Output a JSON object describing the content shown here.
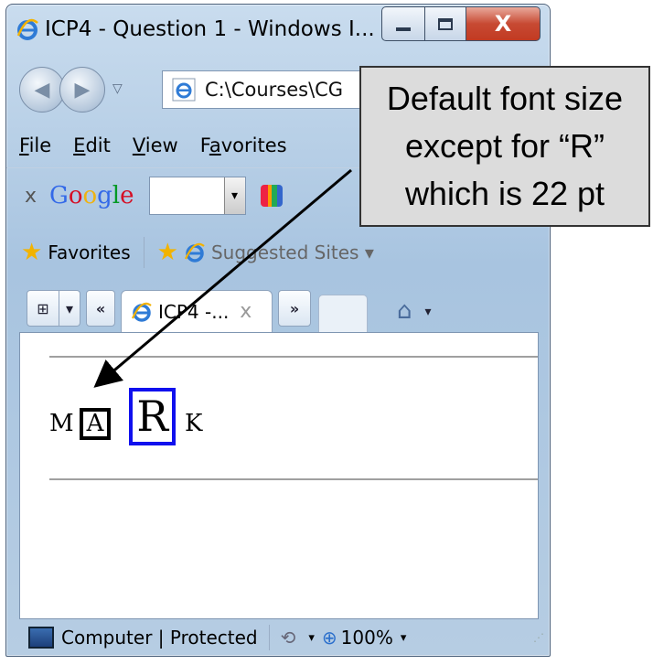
{
  "window": {
    "title": "ICP4 - Question 1 - Windows I...",
    "caption_min": "",
    "caption_max": "",
    "caption_close": "X"
  },
  "address_bar": {
    "url": "C:\\Courses\\CG"
  },
  "menu": {
    "items": [
      {
        "label": "File",
        "key": "F",
        "rest": "ile"
      },
      {
        "label": "Edit",
        "key": "E",
        "rest": "dit"
      },
      {
        "label": "View",
        "key": "V",
        "rest": "iew"
      },
      {
        "label": "Favorites",
        "pre": "F",
        "key": "a",
        "rest": "vorites"
      }
    ]
  },
  "google_bar": {
    "close": "x",
    "logo": "Google",
    "search_value": ""
  },
  "favorites_bar": {
    "favorites_label": "Favorites",
    "suggested_label": "Suggested Sites ▾"
  },
  "tabs": {
    "scroll_left": "«",
    "scroll_right": "»",
    "active_label": "ICP4 -...",
    "active_close": "x",
    "quick_tabs_drop": "▾",
    "home_drop": "▾"
  },
  "page": {
    "letters": [
      "M",
      "A",
      "R",
      "K"
    ]
  },
  "status_bar": {
    "zone": "Computer | Protected",
    "zoom": "100%"
  },
  "callout": {
    "lines": [
      "Default font size",
      "except for “R”",
      "which is 22 pt"
    ]
  },
  "colors": {
    "callout_bg": "#dcdcdc",
    "highlight_a": "#000000",
    "highlight_r": "#1010ee"
  }
}
